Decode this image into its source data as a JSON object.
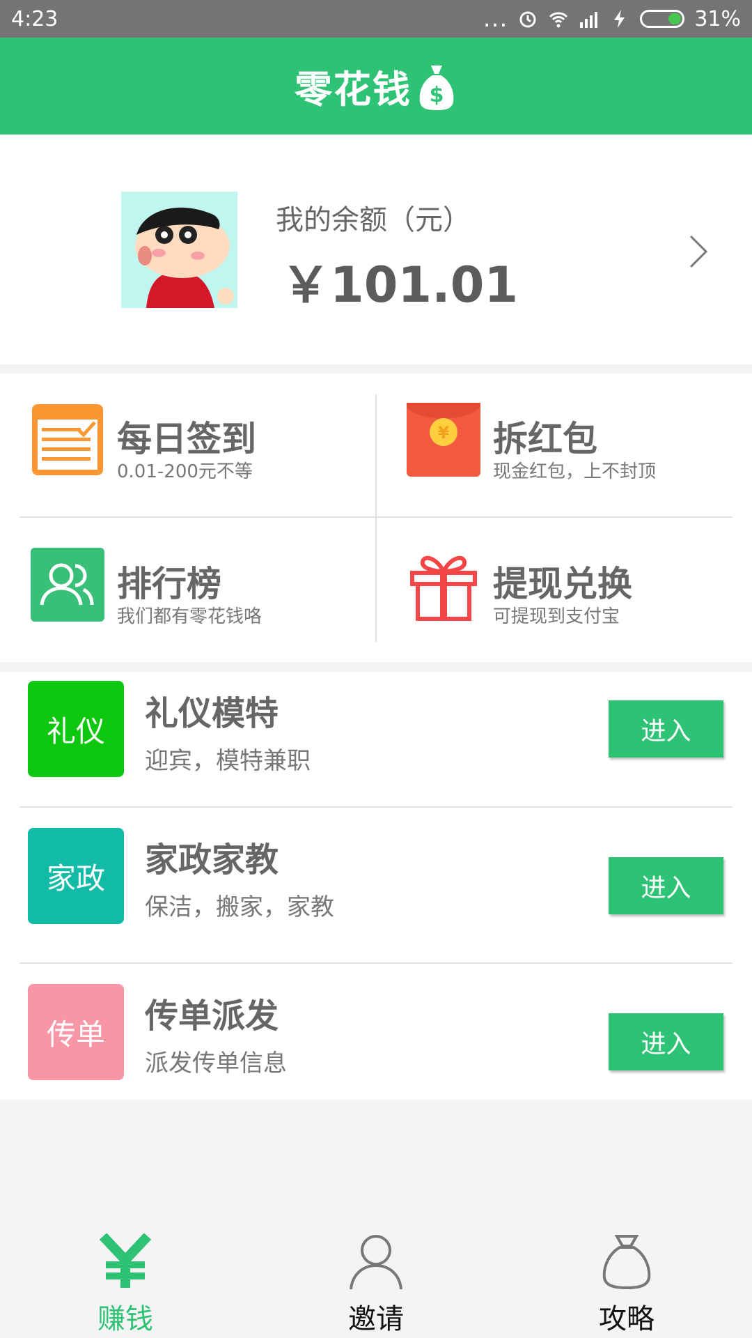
{
  "status_bar": {
    "time": "4:23",
    "dots": "...",
    "battery_pct": "31%"
  },
  "header": {
    "title": "零花钱"
  },
  "balance": {
    "label": "我的余额（元）",
    "amount": "￥101.01"
  },
  "features": [
    {
      "title": "每日签到",
      "subtitle": "0.01-200元不等",
      "icon": "calendar-check-icon"
    },
    {
      "title": "拆红包",
      "subtitle": "现金红包，上不封顶",
      "icon": "red-envelope-icon"
    },
    {
      "title": "排行榜",
      "subtitle": "我们都有零花钱咯",
      "icon": "users-icon"
    },
    {
      "title": "提现兑换",
      "subtitle": "可提现到支付宝",
      "icon": "gift-icon"
    }
  ],
  "jobs": [
    {
      "badge": "礼仪",
      "badge_color": "#0dc80f",
      "title": "礼仪模特",
      "subtitle": "迎宾，模特兼职",
      "button": "进入"
    },
    {
      "badge": "家政",
      "badge_color": "#12bba6",
      "title": "家政家教",
      "subtitle": "保洁，搬家，家教",
      "button": "进入"
    },
    {
      "badge": "传单",
      "badge_color": "#f996a5",
      "title": "传单派发",
      "subtitle": "派发传单信息",
      "button": "进入"
    }
  ],
  "tabs": [
    {
      "label": "赚钱",
      "icon": "yuan-icon",
      "active": true
    },
    {
      "label": "邀请",
      "icon": "person-icon",
      "active": false
    },
    {
      "label": "攻略",
      "icon": "money-bag-icon",
      "active": false
    }
  ],
  "colors": {
    "primary": "#2ec275",
    "text": "#666666"
  }
}
